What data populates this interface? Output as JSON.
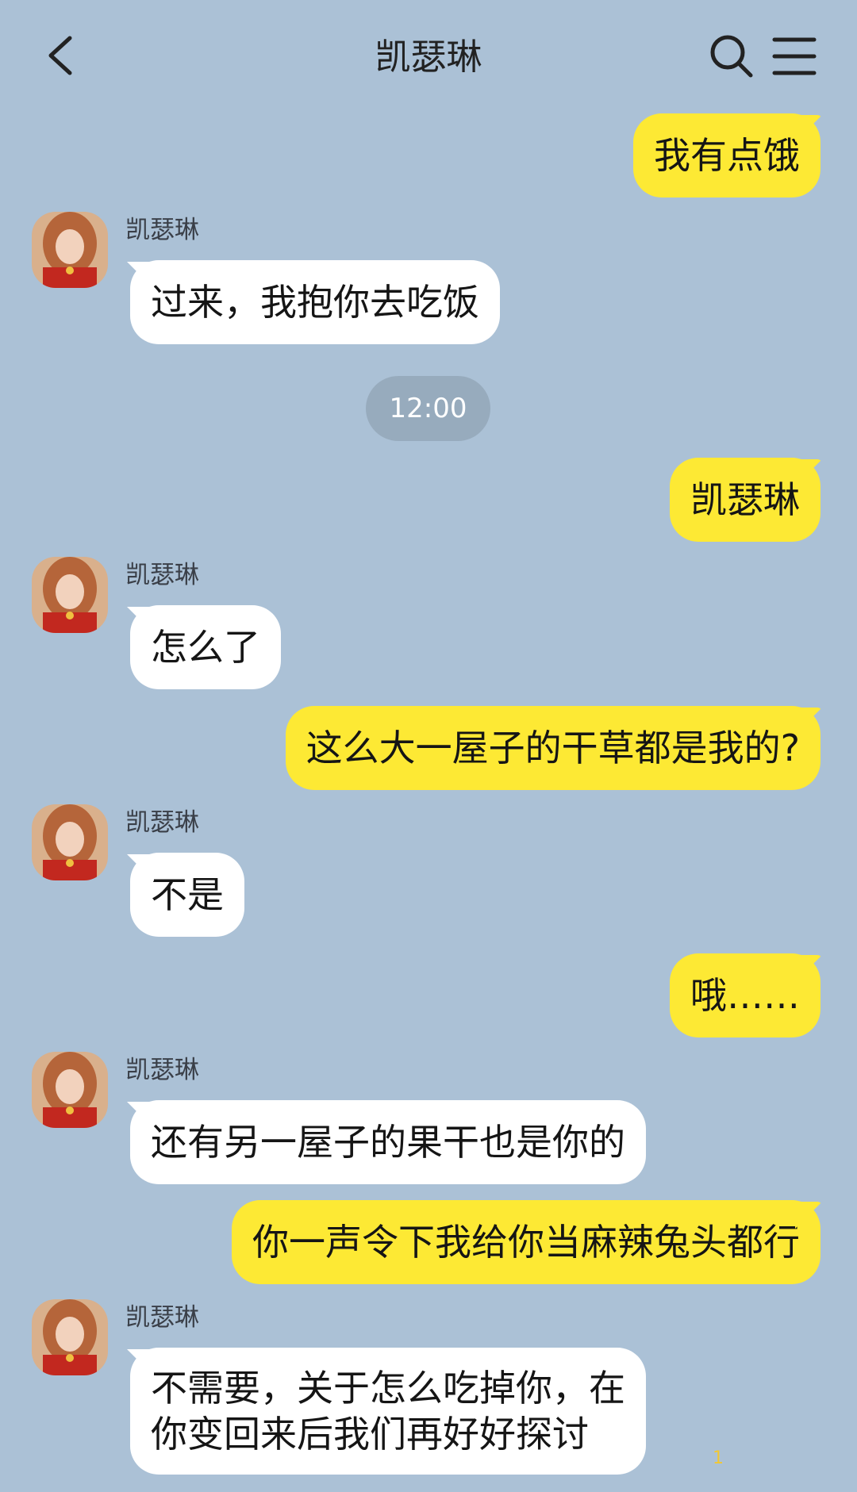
{
  "header": {
    "title": "凯瑟琳",
    "back_icon": "chevron-left-icon",
    "search_icon": "search-icon",
    "menu_icon": "menu-icon"
  },
  "colors": {
    "background": "#abc1d6",
    "outgoing_bubble": "#fde934",
    "incoming_bubble": "#ffffff",
    "time_pill": "#97abbd"
  },
  "messages": [
    {
      "side": "out",
      "text": "我有点饿"
    },
    {
      "side": "in",
      "sender": "凯瑟琳",
      "text": "过来，我抱你去吃饭"
    },
    {
      "type": "time",
      "text": "12:00"
    },
    {
      "side": "out",
      "text": "凯瑟琳"
    },
    {
      "side": "in",
      "sender": "凯瑟琳",
      "text": "怎么了"
    },
    {
      "side": "out",
      "text": "这么大一屋子的干草都是我的?"
    },
    {
      "side": "in",
      "sender": "凯瑟琳",
      "text": "不是"
    },
    {
      "side": "out",
      "text": "哦……"
    },
    {
      "side": "in",
      "sender": "凯瑟琳",
      "text": "还有另一屋子的果干也是你的"
    },
    {
      "side": "out",
      "text": "你一声令下我给你当麻辣兔头都行"
    },
    {
      "side": "in",
      "sender": "凯瑟琳",
      "lines": [
        "不需要，关于怎么吃掉你，在",
        "你变回来后我们再好好探讨"
      ]
    }
  ],
  "unread_count": "1"
}
